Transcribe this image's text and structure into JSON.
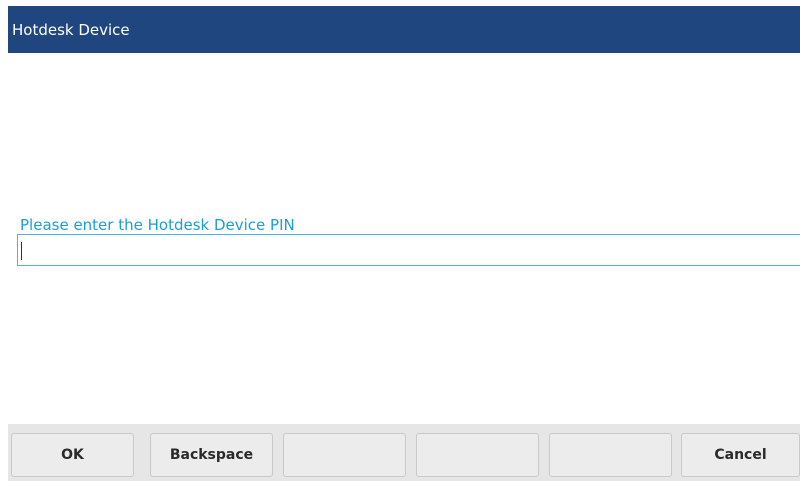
{
  "header": {
    "title": "Hotdesk Device"
  },
  "form": {
    "prompt": "Please enter the Hotdesk Device PIN",
    "pin_value": ""
  },
  "softkeys": [
    {
      "label": "OK"
    },
    {
      "label": "Backspace"
    },
    {
      "label": ""
    },
    {
      "label": ""
    },
    {
      "label": ""
    },
    {
      "label": "Cancel"
    }
  ],
  "colors": {
    "header_bg": "#20467f",
    "header_text": "#ffffff",
    "prompt_text": "#1a9ed8",
    "field_border": "#4fb4e2",
    "softkey_bg": "#ececec"
  }
}
